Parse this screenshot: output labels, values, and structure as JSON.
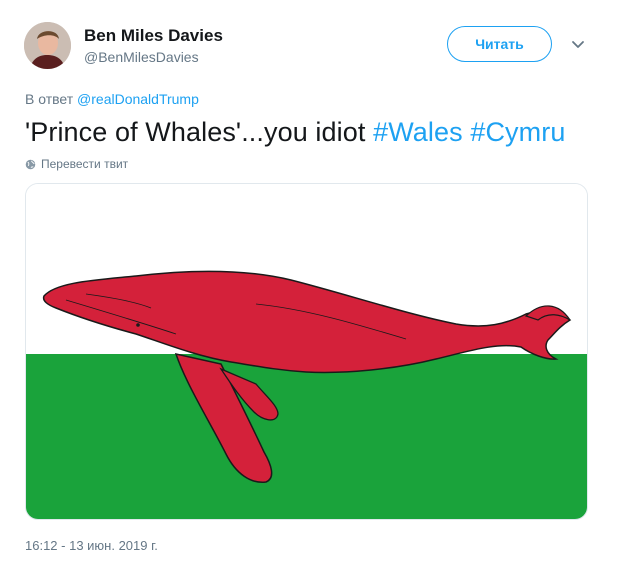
{
  "author": {
    "display_name": "Ben Miles Davies",
    "handle": "@BenMilesDavies"
  },
  "follow_button": {
    "label": "Читать"
  },
  "reply": {
    "prefix": "В ответ",
    "to_handle": "@realDonaldTrump"
  },
  "tweet": {
    "text": "'Prince of Whales'...you idiot",
    "hashtags": [
      "#Wales",
      "#Cymru"
    ]
  },
  "translate_label": "Перевести твит",
  "timestamp": "16:12 - 13 июн. 2019 г.",
  "media": {
    "flag_colors": {
      "top": "#ffffff",
      "bottom": "#1aa33b",
      "whale": "#d4213a"
    }
  },
  "icons": [
    "chevron-down-icon",
    "globe-icon"
  ],
  "colors": {
    "accent": "#1da1f2",
    "muted": "#657786",
    "text": "#14171a"
  }
}
